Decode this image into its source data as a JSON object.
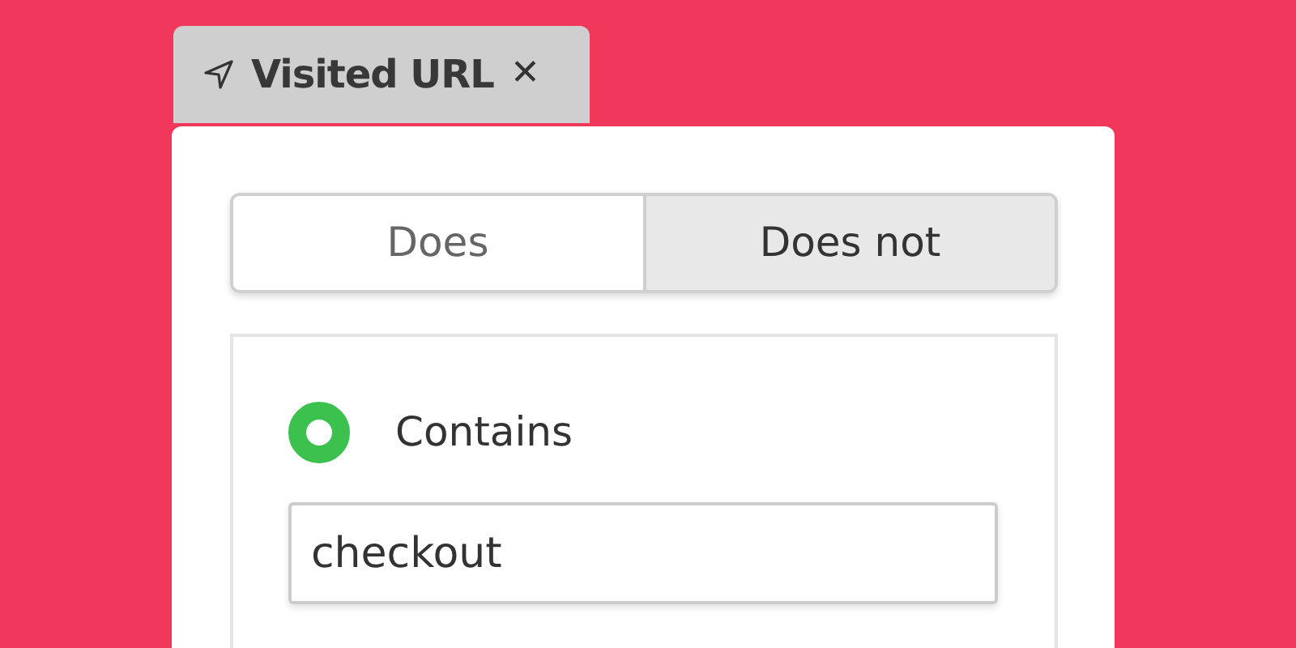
{
  "filter_chip": {
    "label": "Visited URL",
    "close": "✕"
  },
  "modes": [
    {
      "label": "Does",
      "selected": false
    },
    {
      "label": "Does not",
      "selected": true
    }
  ],
  "conditions": [
    {
      "label": "Contains",
      "selected": true,
      "value": "checkout"
    }
  ]
}
